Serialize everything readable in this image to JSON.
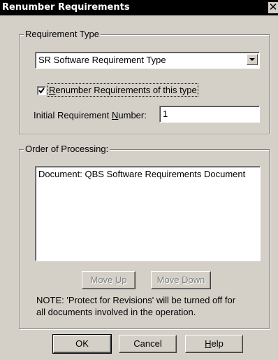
{
  "window": {
    "title": "Renumber Requirements",
    "close_glyph": "✕"
  },
  "requirement_type": {
    "group_label": "Requirement Type",
    "selected_value": "SR   Software Requirement Type",
    "renumber_checked": true,
    "renumber_label_accel": "R",
    "renumber_label_rest": "enumber Requirements of this type",
    "initial_label_pre": "Initial Requirement ",
    "initial_label_accel": "N",
    "initial_label_post": "umber:",
    "initial_value": "1"
  },
  "order": {
    "group_label": "Order of Processing:",
    "items": [
      "Document: QBS Software Requirements Document"
    ],
    "move_up_pre": "Move ",
    "move_up_accel": "U",
    "move_up_post": "p",
    "move_down_pre": "Move ",
    "move_down_accel": "D",
    "move_down_post": "own",
    "note": "NOTE: 'Protect for Revisions' will be turned off for all documents involved in the operation."
  },
  "buttons": {
    "ok": "OK",
    "cancel": "Cancel",
    "help_accel": "H",
    "help_rest": "elp"
  }
}
